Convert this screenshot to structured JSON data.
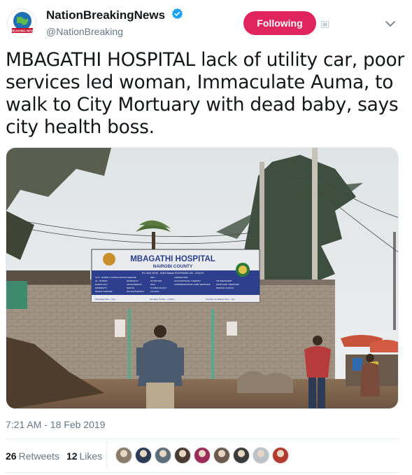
{
  "account": {
    "display_name": "NationBreakingNews",
    "handle": "@NationBreaking",
    "logo_text": "BREAKING NEWS"
  },
  "follow_button_label": "Following",
  "tweet_text": "MBAGATHI HOSPITAL lack of utility car, poor services led woman, Immaculate Auma, to walk to City Mortuary with dead baby, says city health boss.",
  "photo": {
    "sign_title": "MBAGATHI HOSPITAL",
    "sign_subtitle": "NAIROBI COUNTY",
    "sign_contact": "P.O. BOX 20725 - 00202 Nairobi TELEPHONE: 020 - 2724712",
    "sign_services_col1": [
      "OUT - PATIENT CONSULTATION",
      "IN - PATIENT",
      "RADIOLOGY",
      "MATERNITY",
      "MINOR THEATRE"
    ],
    "sign_services_col2": [
      "THEATRE",
      "PHARMACY",
      "ORTHOPAEDIC",
      "DENTAL",
      "PHYSIOTHERAPY"
    ],
    "sign_services_col3": [
      "HDU",
      "NUTRITION",
      "MCH",
      "GYNAECOLOGY",
      "CCC/HIV"
    ],
    "sign_services_col4": [
      "LABORATORY",
      "OCCUPATIONAL THERAPY",
      "COMPREHENSIVE CARE SERVICES"
    ],
    "sign_services_col5": [
      "TB TREATMENT",
      "MORTUARY SERVICES",
      "SPECIAL CLINICS"
    ],
    "sign_footer": [
      "Weekdays 8am - 5pm",
      "Mondays 5:30am - 5.00pm",
      "Sundays & Holidays 9am - 4pm"
    ]
  },
  "timestamp": "7:21 AM - 18 Feb 2019",
  "stats": {
    "retweets_count": "26",
    "retweets_label": "Retweets",
    "likes_count": "12",
    "likes_label": "Likes"
  },
  "likers": [
    {
      "name": "liker-1",
      "color": "#8a7b6a"
    },
    {
      "name": "liker-2",
      "color": "#2b3a55"
    },
    {
      "name": "liker-3",
      "color": "#5b6e7a"
    },
    {
      "name": "liker-4",
      "color": "#4a3b32"
    },
    {
      "name": "liker-5",
      "color": "#9c2b5a"
    },
    {
      "name": "liker-6",
      "color": "#6d5a4e"
    },
    {
      "name": "liker-7",
      "color": "#3b3b3b"
    },
    {
      "name": "liker-8",
      "color": "#b9c3c9"
    },
    {
      "name": "liker-9",
      "color": "#b23a2e"
    }
  ],
  "colors": {
    "follow_button": "#e0245e",
    "verified_badge": "#1da1f2",
    "secondary_text": "#657786"
  },
  "icons": {
    "verified": "verified-badge-icon",
    "caret": "chevron-down-icon",
    "small": "media-icon"
  }
}
